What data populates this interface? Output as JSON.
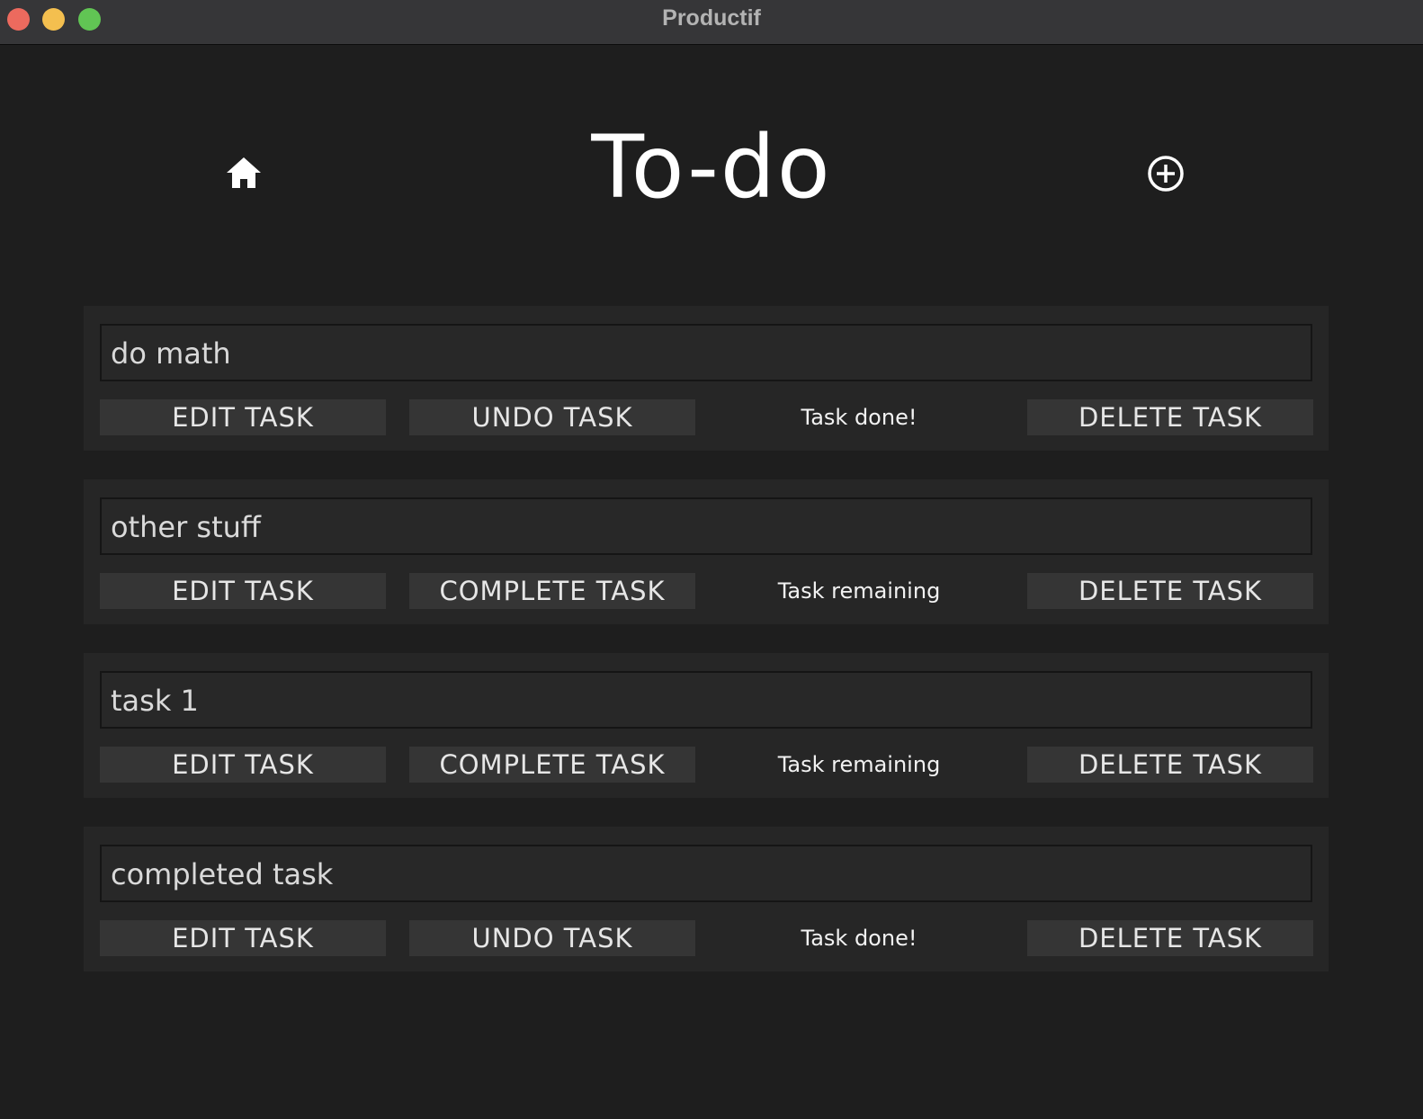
{
  "window": {
    "title": "Productif"
  },
  "header": {
    "title": "To-do",
    "home_icon": "home-icon",
    "add_icon": "plus-circle-icon"
  },
  "colors": {
    "background": "#1e1e1e",
    "card": "#262626",
    "button": "#353535",
    "text": "#ffffff"
  },
  "tasks": [
    {
      "name": "do math",
      "edit_label": "EDIT TASK",
      "toggle_label": "UNDO TASK",
      "status": "Task done!",
      "delete_label": "DELETE TASK"
    },
    {
      "name": "other stuff",
      "edit_label": "EDIT TASK",
      "toggle_label": "COMPLETE TASK",
      "status": "Task remaining",
      "delete_label": "DELETE TASK"
    },
    {
      "name": "task 1",
      "edit_label": "EDIT TASK",
      "toggle_label": "COMPLETE TASK",
      "status": "Task remaining",
      "delete_label": "DELETE TASK"
    },
    {
      "name": "completed task",
      "edit_label": "EDIT TASK",
      "toggle_label": "UNDO TASK",
      "status": "Task done!",
      "delete_label": "DELETE TASK"
    }
  ]
}
